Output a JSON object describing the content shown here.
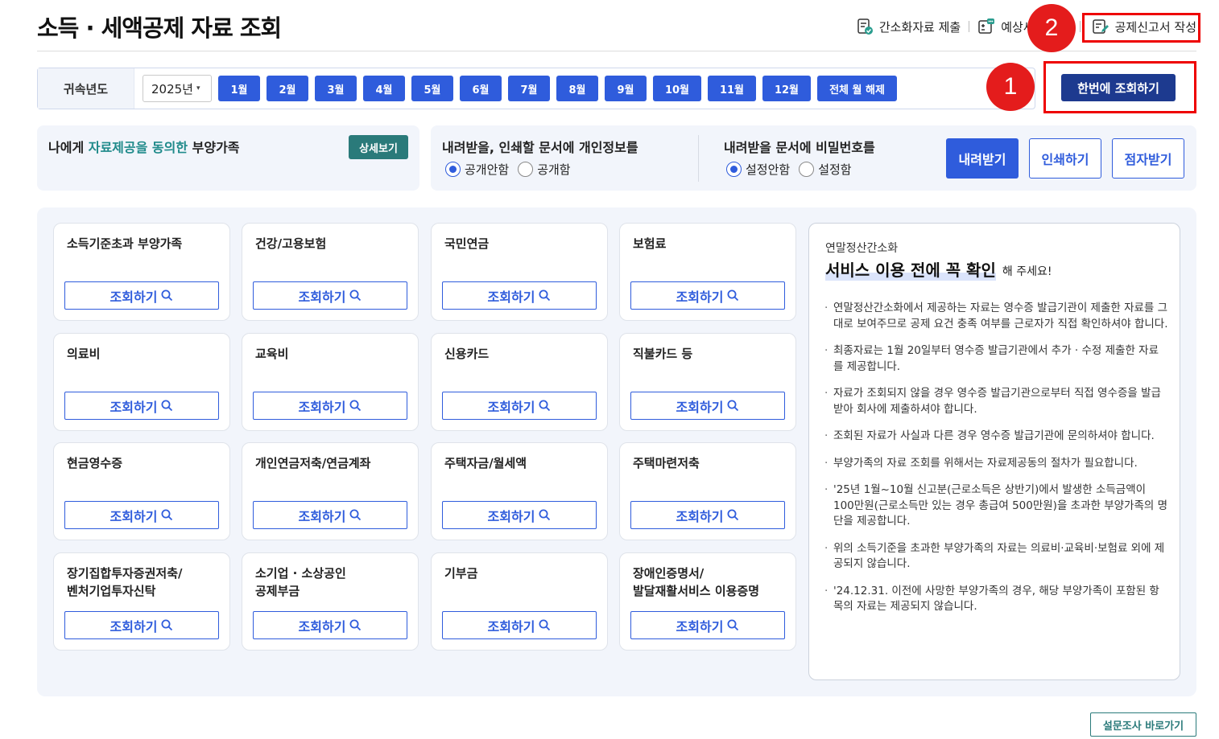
{
  "page_title": "소득 · 세액공제 자료 조회",
  "top_actions": {
    "simple_submit": "간소화자료 제출",
    "estimate": "예상세",
    "write_deduction": "공제신고서 작성"
  },
  "markers": {
    "step1": "1",
    "step2": "2"
  },
  "filter": {
    "label": "귀속년도",
    "year": "2025년",
    "months": [
      "1월",
      "2월",
      "3월",
      "4월",
      "5월",
      "6월",
      "7월",
      "8월",
      "9월",
      "10월",
      "11월",
      "12월"
    ],
    "clear_all": "전체 월 해제",
    "query_all": "한번에 조회하기"
  },
  "dependents": {
    "title_pre": "나에게 ",
    "title_highlight": "자료제공을 동의한",
    "title_post": " 부양가족",
    "detail_button": "상세보기"
  },
  "download_options": {
    "privacy_title": "내려받을, 인쇄할 문서에 개인정보를",
    "privacy_options": [
      "공개안함",
      "공개함"
    ],
    "password_title": "내려받을 문서에 비밀번호를",
    "password_options": [
      "설정안함",
      "설정함"
    ],
    "download_button": "내려받기",
    "print_button": "인쇄하기",
    "braille_button": "점자받기"
  },
  "cards": [
    {
      "title": "소득기준초과 부양가족",
      "button": "조회하기"
    },
    {
      "title": "건강/고용보험",
      "button": "조회하기"
    },
    {
      "title": "국민연금",
      "button": "조회하기"
    },
    {
      "title": "보험료",
      "button": "조회하기"
    },
    {
      "title": "의료비",
      "button": "조회하기"
    },
    {
      "title": "교육비",
      "button": "조회하기"
    },
    {
      "title": "신용카드",
      "button": "조회하기"
    },
    {
      "title": "직불카드 등",
      "button": "조회하기"
    },
    {
      "title": "현금영수증",
      "button": "조회하기"
    },
    {
      "title": "개인연금저축/연금계좌",
      "button": "조회하기"
    },
    {
      "title": "주택자금/월세액",
      "button": "조회하기"
    },
    {
      "title": "주택마련저축",
      "button": "조회하기"
    },
    {
      "title": "장기집합투자증권저축/\n벤처기업투자신탁",
      "button": "조회하기"
    },
    {
      "title": "소기업 · 소상공인\n공제부금",
      "button": "조회하기"
    },
    {
      "title": "기부금",
      "button": "조회하기"
    },
    {
      "title": "장애인증명서/\n발달재활서비스 이용증명",
      "button": "조회하기"
    }
  ],
  "info": {
    "subtitle": "연말정산간소화",
    "headline": "서비스 이용 전에 꼭 확인",
    "headline_tail": "해 주세요!",
    "items": [
      "연말정산간소화에서 제공하는 자료는 영수증 발급기관이 제출한 자료를 그대로 보여주므로 공제 요건 충족 여부를 근로자가 직접 확인하셔야 합니다.",
      "최종자료는 1월 20일부터 영수증 발급기관에서 추가 · 수정 제출한 자료를 제공합니다.",
      "자료가 조회되지 않을 경우 영수증 발급기관으로부터 직접 영수증을 발급받아 회사에 제출하셔야 합니다.",
      "조회된 자료가 사실과 다른 경우 영수증 발급기관에 문의하셔야 합니다.",
      "부양가족의 자료 조회를 위해서는 자료제공동의 절차가 필요합니다.",
      "'25년 1월~10월 신고분(근로소득은 상반기)에서 발생한 소득금액이 100만원(근로소득만 있는 경우 총급여 500만원)을 초과한 부양가족의 명단을 제공합니다.",
      "위의 소득기준을 초과한 부양가족의 자료는 의료비·교육비·보험료 외에 제공되지 않습니다.",
      "'24.12.31. 이전에 사망한 부양가족의 경우, 해당 부양가족이 포함된 항목의 자료는 제공되지 않습니다."
    ]
  },
  "survey_button": "설문조사 바로가기",
  "colors": {
    "primary_blue": "#2f5cdc",
    "navy": "#1d3a8f",
    "teal": "#2a7a7a",
    "marker_red": "#e41c1c"
  }
}
